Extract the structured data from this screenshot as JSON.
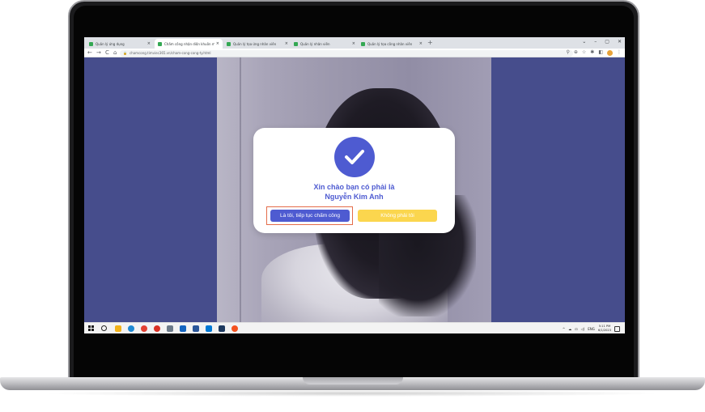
{
  "browser": {
    "tabs": [
      {
        "label": "Quản lý ứng dụng",
        "favicon_color": "#34a853",
        "active": false
      },
      {
        "label": "Chấm công nhận diện khuôn m...",
        "favicon_color": "#34a853",
        "active": true
      },
      {
        "label": "Quản lý tọa ứng nhân viên",
        "favicon_color": "#34a853",
        "active": false
      },
      {
        "label": "Quản lý nhân viên",
        "favicon_color": "#34a853",
        "active": false
      },
      {
        "label": "Quản lý tọa công nhân viên",
        "favicon_color": "#34a853",
        "active": false
      }
    ],
    "new_tab": "+",
    "window_controls": [
      "⌄",
      "–",
      "▢",
      "✕"
    ],
    "nav": {
      "back": "←",
      "forward": "→",
      "reload": "C",
      "home": "⌂"
    },
    "url": "chamcong.timviec365.vn/cham-cong-cong-ty.html",
    "lock": "🔒",
    "toolbar_icons": [
      "⚲",
      "⊕",
      "☆",
      "✱",
      "◧"
    ]
  },
  "dialog": {
    "line1": "Xin chào bạn có phải là",
    "line2": "Nguyễn Kim Anh",
    "confirm_label": "Là tôi, tiếp tục chấm công",
    "reject_label": "Không phải tôi",
    "accent": "#4e5bd1",
    "reject_color": "#fbd64e"
  },
  "taskbar": {
    "lang": "ENG",
    "time": "5:11 PM",
    "date": "6/1/2023",
    "tray_icons": [
      "^",
      "☁",
      "⊡",
      "◁)"
    ]
  },
  "colors": {
    "page_background": "#464d8c",
    "highlight_frame": "#e46c4a"
  }
}
